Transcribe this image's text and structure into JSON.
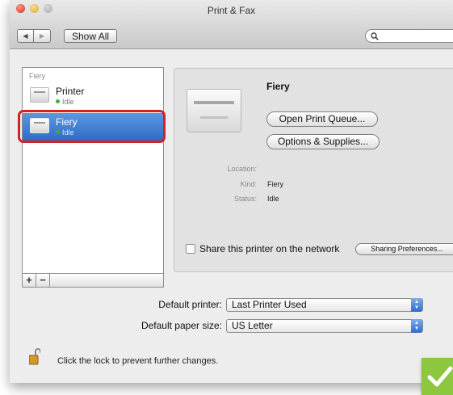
{
  "window": {
    "title": "Print & Fax"
  },
  "toolbar": {
    "back_label": "◀",
    "forward_label": "▶",
    "show_all_label": "Show All",
    "search_placeholder": ""
  },
  "printer_list": {
    "group_label": "Fiery",
    "items": [
      {
        "name": "Printer",
        "status": "Idle",
        "selected": false
      },
      {
        "name": "Fiery",
        "status": "Idle",
        "selected": true
      }
    ],
    "add_label": "+",
    "remove_label": "−"
  },
  "details": {
    "name": "Fiery",
    "open_queue_label": "Open Print Queue...",
    "options_supplies_label": "Options & Supplies...",
    "location_label": "Location:",
    "location_value": "",
    "kind_label": "Kind:",
    "kind_value": "Fiery",
    "status_label": "Status:",
    "status_value": "Idle",
    "share_label": "Share this printer on the network",
    "share_checked": false,
    "sharing_prefs_label": "Sharing Preferences..."
  },
  "defaults": {
    "default_printer_label": "Default printer:",
    "default_printer_value": "Last Printer Used",
    "default_paper_label": "Default paper size:",
    "default_paper_value": "US Letter"
  },
  "lock": {
    "text": "Click the lock to prevent further changes."
  },
  "colors": {
    "selection": "#3b7bd4",
    "highlight_outline": "#d42222",
    "done_badge": "#8dc63f"
  },
  "icons": {
    "lock": "lock-open-icon",
    "done": "checkmark-icon",
    "search": "search-icon"
  }
}
